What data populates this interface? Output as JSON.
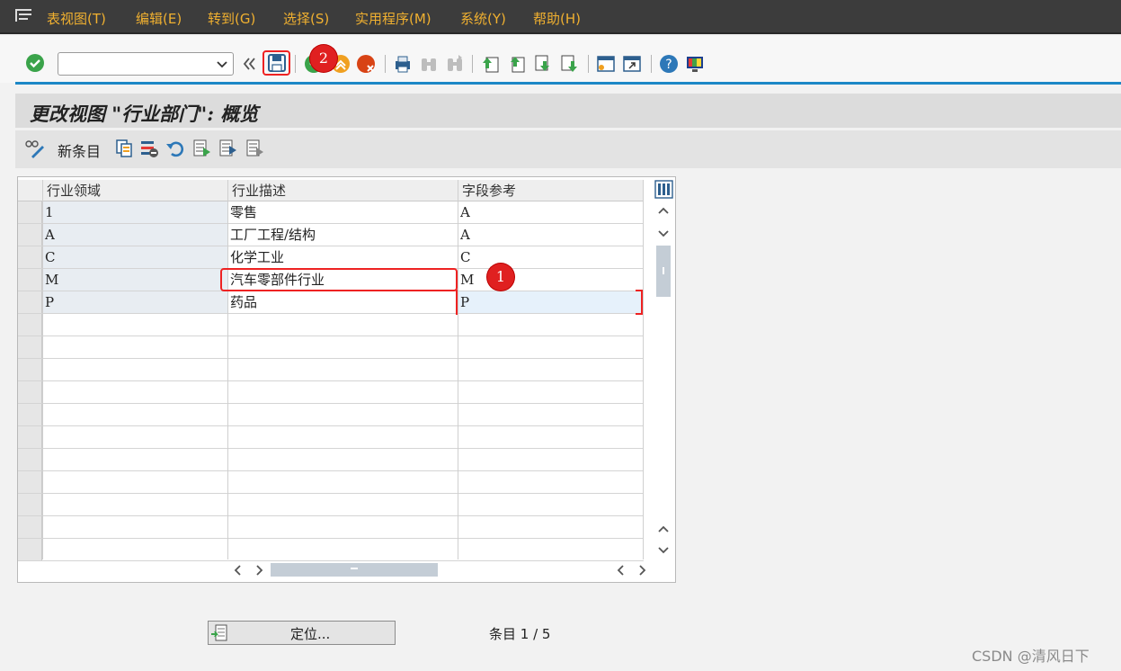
{
  "menubar": {
    "items": [
      "表视图(T)",
      "编辑(E)",
      "转到(G)",
      "选择(S)",
      "实用程序(M)",
      "系统(Y)",
      "帮助(H)"
    ]
  },
  "toolbar": {
    "command_field_value": "",
    "icons": [
      "enter-icon",
      "back-double-icon",
      "save-icon",
      "back-icon",
      "exit-icon",
      "cancel-icon",
      "print-icon",
      "find-icon",
      "find-next-icon",
      "first-page-icon",
      "prev-page-icon",
      "next-page-icon",
      "last-page-icon",
      "create-session-icon",
      "shortcut-icon",
      "help-icon",
      "customize-layout-icon"
    ]
  },
  "page": {
    "title": "更改视图 \"行业部门\": 概览"
  },
  "app_toolbar": {
    "new_entries_label": "新条目"
  },
  "table": {
    "columns": [
      "行业领域",
      "行业描述",
      "字段参考"
    ],
    "rows": [
      {
        "sector": "1",
        "description": "零售",
        "field_ref": "A"
      },
      {
        "sector": "A",
        "description": "工厂工程/结构",
        "field_ref": "A"
      },
      {
        "sector": "C",
        "description": "化学工业",
        "field_ref": "C"
      },
      {
        "sector": "M",
        "description": "汽车零部件行业",
        "field_ref": "M"
      },
      {
        "sector": "P",
        "description": "药品",
        "field_ref": "P"
      }
    ]
  },
  "footer": {
    "position_button": "定位...",
    "entry_count": "条目 1 / 5"
  },
  "annotations": {
    "badge1": "1",
    "badge2": "2"
  },
  "watermark": "CSDN @清风日下",
  "colors": {
    "menubar_bg": "#3c3c3c",
    "menu_text": "#f0b030",
    "accent_line": "#1c87c6",
    "annotation_red": "#e02020"
  }
}
